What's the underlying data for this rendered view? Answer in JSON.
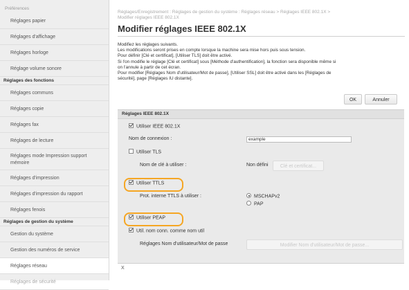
{
  "sidebar": {
    "top_label": "Préférences",
    "items_a": [
      {
        "label": "Réglages papier"
      },
      {
        "label": "Réglages d'affichage"
      },
      {
        "label": "Réglages horloge"
      },
      {
        "label": "Réglage volume sonore"
      }
    ],
    "section_functions": "Réglages des fonctions",
    "items_b": [
      {
        "label": "Réglages communs"
      },
      {
        "label": "Réglages copie"
      },
      {
        "label": "Réglages fax"
      },
      {
        "label": "Réglages de lecture"
      },
      {
        "label": "Réglages mode Impression support mémoire"
      },
      {
        "label": "Réglages d'impression"
      },
      {
        "label": "Réglages d'impression du rapport"
      },
      {
        "label": "Réglages fenois"
      }
    ],
    "section_system": "Réglages de gestion du système",
    "items_c": [
      {
        "label": "Gestion du système"
      },
      {
        "label": "Gestion des numéros de service"
      },
      {
        "label": "Réglages réseau"
      },
      {
        "label": "Réglages de sécurité"
      }
    ]
  },
  "main": {
    "breadcrumb_line1": "Réglages/Enregistrement : Réglages de gestion du système : Réglages réseau > Réglages IEEE 802.1X >",
    "breadcrumb_line2": "Modifier réglages IEEE 802.1X",
    "title": "Modifier réglages IEEE 802.1X",
    "description": [
      "Modifiez les réglages suivants.",
      "Les modifications seront prises en compte lorsque la machine sera mise hors puis sous tension.",
      "Pour définir [Clé et certificat], [Utiliser TLS] doit être activé.",
      "Si l'on modifie le réglage [Clé et certificat] sous [Méthode d'authentification], la fonction sera disponible même si",
      "on l'annule à partir de cet écran.",
      "Pour modifier [Réglages Nom d'utilisateur/Mot de passe], [Utiliser SSL] doit être activé dans les [Réglages de",
      "sécurité], page [Réglages IU distante]."
    ],
    "ok_label": "OK",
    "cancel_label": "Annuler"
  },
  "panel": {
    "header": "Réglages IEEE 802.1X",
    "use_ieee_label": "Utiliser IEEE 802.1X",
    "login_name_label": "Nom de connexion :",
    "login_name_value": "example",
    "use_tls_label": "Utiliser TLS",
    "key_name_label": "Nom de clé à utiliser :",
    "key_name_value": "Non défini",
    "key_cert_button": "Clé et certificat...",
    "use_ttls_label": "Utiliser TTLS",
    "ttls_protocol_label": "Prot. interne TTLS à utiliser :",
    "ttls_option_1": "MSCHAPv2",
    "ttls_option_2": "PAP",
    "use_peap_label": "Utiliser PEAP",
    "use_login_as_user_label": "Util. nom conn. comme nom util",
    "user_pass_settings_label": "Réglages Nom d'utilisateur/Mot de passe",
    "user_pass_button": "Modifier Nom d'utilisateur/Mot de passe...",
    "page_marker": "X"
  },
  "colors": {
    "highlight": "#f5a623",
    "sidebar_bg": "#eeeeee",
    "panel_bg": "#eaeaea"
  }
}
